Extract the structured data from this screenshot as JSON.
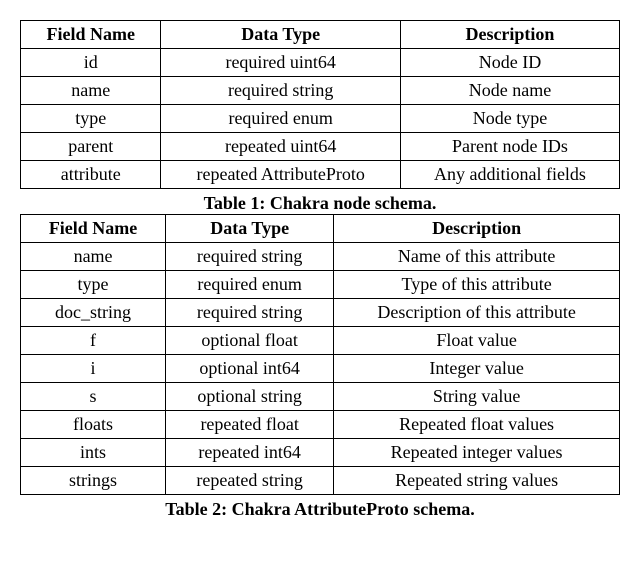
{
  "table1": {
    "headers": [
      "Field Name",
      "Data Type",
      "Description"
    ],
    "rows": [
      [
        "id",
        "required uint64",
        "Node ID"
      ],
      [
        "name",
        "required string",
        "Node name"
      ],
      [
        "type",
        "required enum",
        "Node type"
      ],
      [
        "parent",
        "repeated uint64",
        "Parent node IDs"
      ],
      [
        "attribute",
        "repeated AttributeProto",
        "Any additional fields"
      ]
    ],
    "caption": "Table 1: Chakra node schema."
  },
  "table2": {
    "headers": [
      "Field Name",
      "Data Type",
      "Description"
    ],
    "rows": [
      [
        "name",
        "required string",
        "Name of this attribute"
      ],
      [
        "type",
        "required enum",
        "Type of this attribute"
      ],
      [
        "doc_string",
        "required string",
        "Description of this attribute"
      ],
      [
        "f",
        "optional float",
        "Float value"
      ],
      [
        "i",
        "optional int64",
        "Integer value"
      ],
      [
        "s",
        "optional string",
        "String value"
      ],
      [
        "floats",
        "repeated float",
        "Repeated float values"
      ],
      [
        "ints",
        "repeated int64",
        "Repeated integer values"
      ],
      [
        "strings",
        "repeated string",
        "Repeated string values"
      ]
    ],
    "caption": "Table 2: Chakra AttributeProto schema."
  }
}
